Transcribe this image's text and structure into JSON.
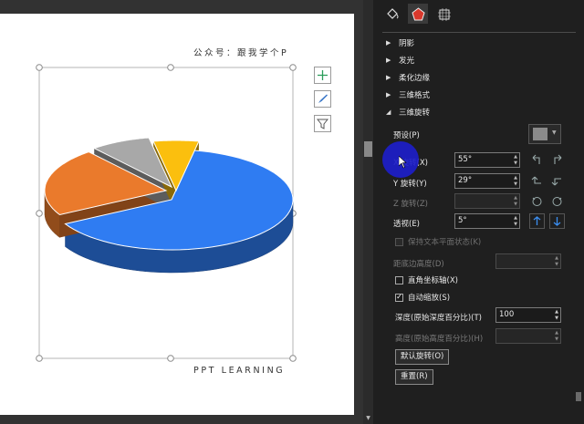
{
  "slide": {
    "wechat": "公众号：跟我学个P",
    "brand": "PPT LEARNING"
  },
  "chart_data": {
    "type": "pie",
    "categories": [
      "Blue",
      "Orange",
      "Gray",
      "Yellow"
    ],
    "values": [
      64,
      22,
      8,
      6
    ],
    "colors": [
      "#2f7cf2",
      "#ea7a2c",
      "#a8a8a8",
      "#fbbf0e"
    ],
    "style": "3d-exploded",
    "x_rotation_deg": 55,
    "y_rotation_deg": 29,
    "perspective_deg": 5
  },
  "side_buttons": [
    "plus-icon",
    "brush-icon",
    "filter-icon"
  ],
  "panel": {
    "tabs": [
      "fill-icon",
      "effects-icon",
      "size-icon"
    ],
    "sections": {
      "shadow": "阴影",
      "glow": "发光",
      "soft_edges": "柔化边缘",
      "format3d": "三维格式",
      "rotation3d": "三维旋转"
    },
    "preset_label": "预设(P)",
    "x_label": "X 旋转(X)",
    "x_value": "55°",
    "y_label": "Y 旋转(Y)",
    "y_value": "29°",
    "z_label": "Z 旋转(Z)",
    "persp_label": "透视(E)",
    "persp_value": "5°",
    "keep_text_flat": "保持文本平面状态(K)",
    "distance_label": "距底边高度(D)",
    "right_angle": "直角坐标轴(X)",
    "autoscale": "自动缩放(S)",
    "depth_label": "深度(原始深度百分比)(T)",
    "depth_value": "100",
    "height_label": "高度(原始高度百分比)(H)",
    "reset_rotation": "默认旋转(O)",
    "reset": "重置(R)"
  }
}
